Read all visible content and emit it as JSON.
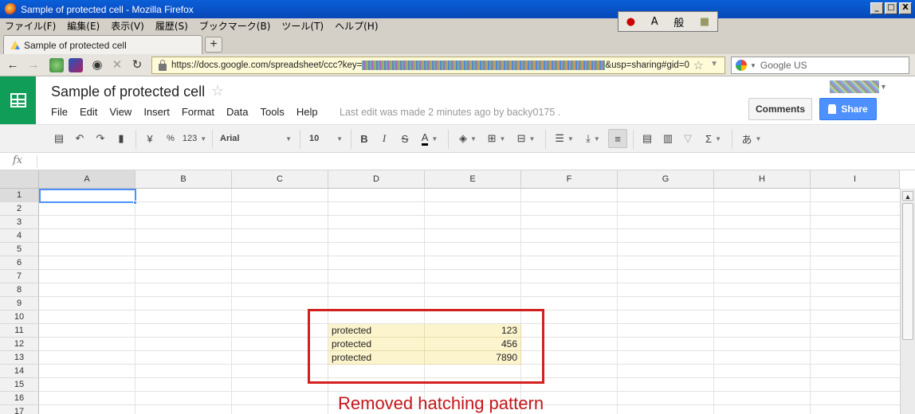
{
  "window": {
    "title": "Sample of protected cell - Mozilla Firefox",
    "controls": [
      "_",
      "□",
      "X"
    ]
  },
  "firefox_menu": [
    "ファイル(F)",
    "編集(E)",
    "表示(V)",
    "履歴(S)",
    "ブックマーク(B)",
    "ツール(T)",
    "ヘルプ(H)"
  ],
  "ime_toolbar": {
    "mode": "A",
    "label": "般"
  },
  "tab": {
    "label": "Sample of protected cell",
    "new_tab": "+"
  },
  "nav": {
    "url_prefix": "https://docs.google.com/spreadsheet/ccc?key=",
    "url_suffix": "&usp=sharing#gid=0",
    "search_placeholder": "Google US"
  },
  "doc": {
    "title": "Sample of protected cell",
    "menu": [
      "File",
      "Edit",
      "View",
      "Insert",
      "Format",
      "Data",
      "Tools",
      "Help"
    ],
    "last_edit": "Last edit was made 2 minutes ago by backy0175 .",
    "comments_label": "Comments",
    "share_label": "Share"
  },
  "toolbar": {
    "currency": "¥",
    "percent": "%",
    "number_format": "123",
    "font": "Arial",
    "font_size": "10",
    "bold": "B",
    "italic": "I",
    "strike": "S",
    "text_color": "A",
    "sum": "Σ",
    "input_tools": "あ"
  },
  "formula": {
    "fx": "fx"
  },
  "grid": {
    "columns": [
      "A",
      "B",
      "C",
      "D",
      "E",
      "F",
      "G",
      "H",
      "I"
    ],
    "rows": [
      "1",
      "2",
      "3",
      "4",
      "5",
      "6",
      "7",
      "8",
      "9",
      "10",
      "11",
      "12",
      "13",
      "14",
      "15",
      "16",
      "17"
    ],
    "selected_cell": "A1",
    "protected_cells": [
      {
        "label": "protected",
        "value": "123"
      },
      {
        "label": "protected",
        "value": "456"
      },
      {
        "label": "protected",
        "value": "7890"
      }
    ],
    "protected_fill": "#fcf4cd"
  },
  "annotation": {
    "text": "Removed hatching pattern",
    "color": "#c4161c"
  }
}
